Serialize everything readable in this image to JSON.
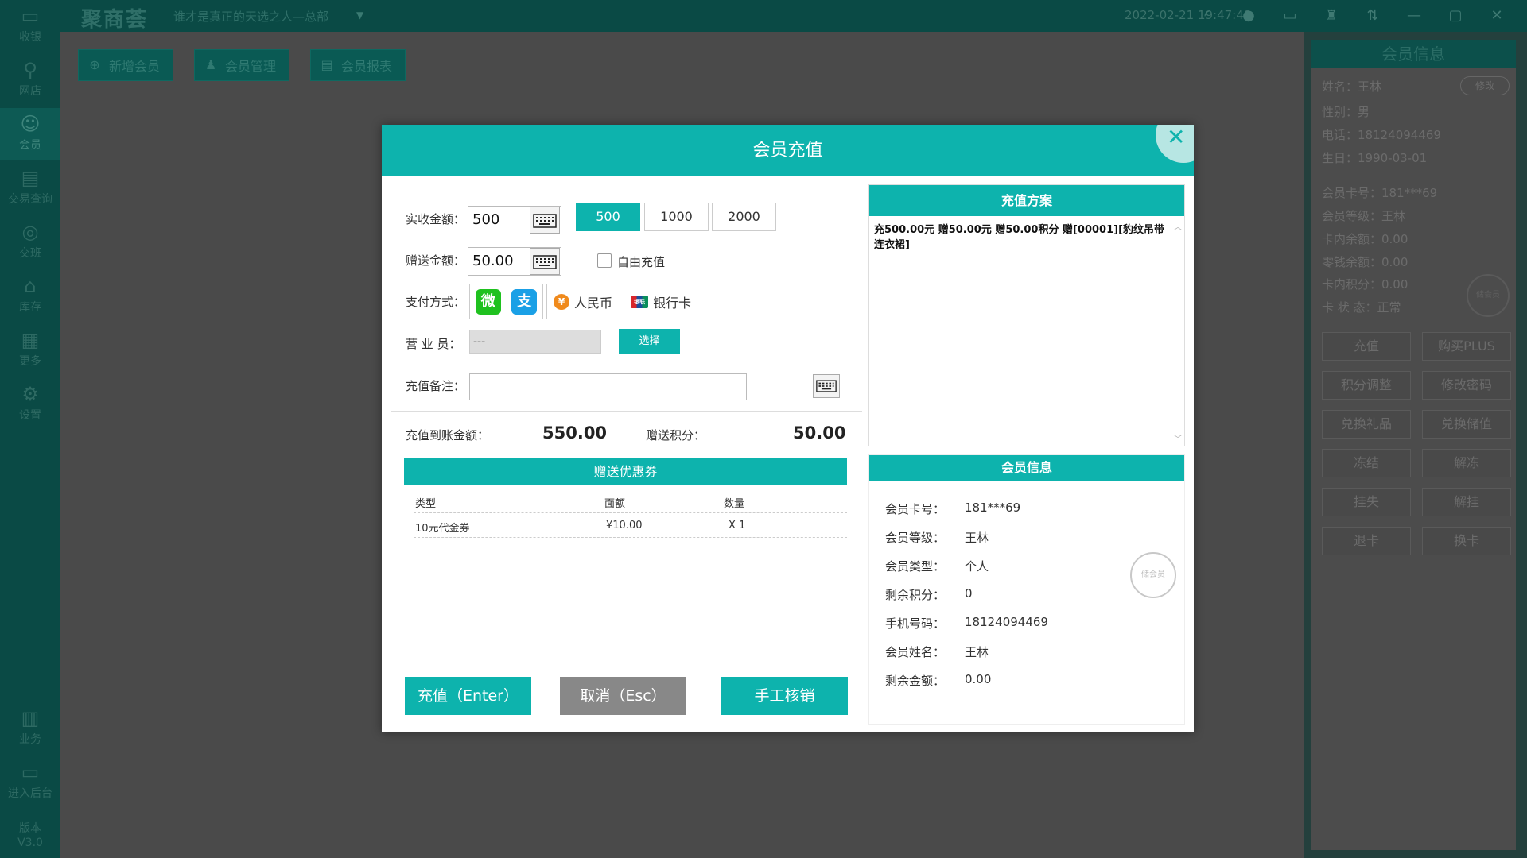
{
  "header": {
    "brand": "聚商荟",
    "store": "谁才是真正的天选之人—总部",
    "datetime": "2022-02-21 19:47:48"
  },
  "nav": {
    "items": [
      {
        "label": "收银",
        "icon": "monitor-icon"
      },
      {
        "label": "网店",
        "icon": "bicycle-icon"
      },
      {
        "label": "会员",
        "icon": "user-icon"
      },
      {
        "label": "交易查询",
        "icon": "document-icon"
      },
      {
        "label": "交班",
        "icon": "shift-icon"
      },
      {
        "label": "库存",
        "icon": "warehouse-icon"
      },
      {
        "label": "更多",
        "icon": "grid-icon"
      },
      {
        "label": "设置",
        "icon": "gear-icon"
      },
      {
        "label": "业务",
        "icon": "book-icon"
      },
      {
        "label": "进入后台",
        "icon": "screen-icon"
      }
    ],
    "version_label": "版本",
    "version": "V3.0"
  },
  "actions": {
    "add_member": "新增会员",
    "member_manage": "会员管理",
    "member_report": "会员报表"
  },
  "side": {
    "title": "会员信息",
    "edit": "修改",
    "name": "姓名：王林",
    "gender": "性别：男",
    "phone": "电话：18124094469",
    "birthday": "生日：1990-03-01",
    "card_no": "会员卡号：181***69",
    "level": "会员等级：王林",
    "card_balance": "卡内余额：0.00",
    "change_balance": "零钱余额：0.00",
    "card_points": "卡内积分：0.00",
    "card_status": "卡 状 态：正常",
    "stamp": "储会员",
    "buttons": [
      "充值",
      "购买PLUS",
      "积分调整",
      "修改密码",
      "兑换礼品",
      "兑换储值",
      "冻结",
      "解冻",
      "挂失",
      "解挂",
      "退卡",
      "换卡"
    ]
  },
  "modal": {
    "title": "会员充值",
    "received_label": "实收金额：",
    "received_value": "500",
    "presets": [
      "500",
      "1000",
      "2000"
    ],
    "gift_label": "赠送金额：",
    "gift_value": "50.00",
    "free_recharge": "自由充值",
    "pay_label": "支付方式：",
    "pay_wechat_glyph": "微",
    "pay_alipay_glyph": "支",
    "pay_rmb_glyph": "¥",
    "pay_rmb": "人民币",
    "pay_card_glyph": "银联",
    "pay_card": "银行卡",
    "staff_label": "营 业 员：",
    "staff_value": "---",
    "select_btn": "选择",
    "remark_label": "充值备注：",
    "arrive_label": "充值到账金额：",
    "arrive_value": "550.00",
    "points_label": "赠送积分：",
    "points_value": "50.00",
    "coupon_title": "赠送优惠券",
    "coupon_columns": [
      "类型",
      "面额",
      "数量"
    ],
    "coupons": [
      {
        "type": "10元代金券",
        "amount": "¥10.00",
        "qty": "X 1"
      }
    ],
    "btn_recharge": "充值（Enter）",
    "btn_cancel": "取消（Esc）",
    "btn_manual": "手工核销",
    "plan_title": "充值方案",
    "plan_text": "充500.00元 赠50.00元 赠50.00积分 赠[00001][豹纹吊带连衣裙]",
    "info_title": "会员信息",
    "info": [
      {
        "label": "会员卡号：",
        "value": "181***69"
      },
      {
        "label": "会员等级：",
        "value": "王林"
      },
      {
        "label": "会员类型：",
        "value": "个人"
      },
      {
        "label": "剩余积分：",
        "value": "0"
      },
      {
        "label": "手机号码：",
        "value": "18124094469"
      },
      {
        "label": "会员姓名：",
        "value": "王林"
      },
      {
        "label": "剩余金额：",
        "value": "0.00"
      }
    ],
    "info_stamp": "储会员"
  }
}
